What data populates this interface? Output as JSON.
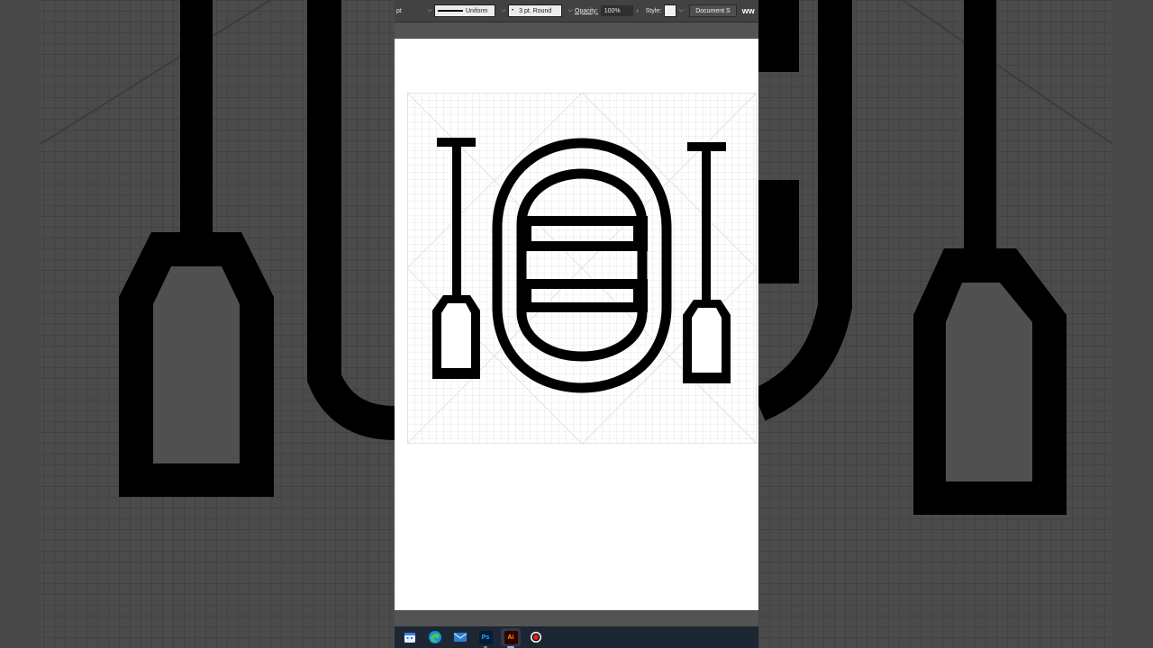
{
  "control_bar": {
    "stroke_unit": "pt",
    "variable_width_profile": "Uniform",
    "brush_definition": "3 pt. Round",
    "opacity_label": "Opacity:",
    "opacity_value": "100%",
    "style_label": "Style:",
    "document_setup_label": "Document S",
    "overflow_text": "ww"
  },
  "taskbar": {
    "apps": [
      {
        "name": "calendar-app",
        "icon": "calendar-icon"
      },
      {
        "name": "edge-browser",
        "icon": "edge-icon"
      },
      {
        "name": "mail-app",
        "icon": "mail-icon"
      },
      {
        "name": "photoshop",
        "icon": "photoshop-icon",
        "label": "Ps"
      },
      {
        "name": "illustrator",
        "icon": "illustrator-icon",
        "label": "Ai",
        "active": true
      },
      {
        "name": "screen-recorder",
        "icon": "record-icon"
      }
    ]
  },
  "artwork": {
    "subject": "raft with two paddles",
    "stroke_color": "#000000",
    "grid_color": "#cfcfcf"
  },
  "colors": {
    "app_chrome": "#535353",
    "control_bar": "#424242",
    "artboard": "#ffffff",
    "taskbar": "#1d2733",
    "backdrop": "#4a4a4a"
  }
}
